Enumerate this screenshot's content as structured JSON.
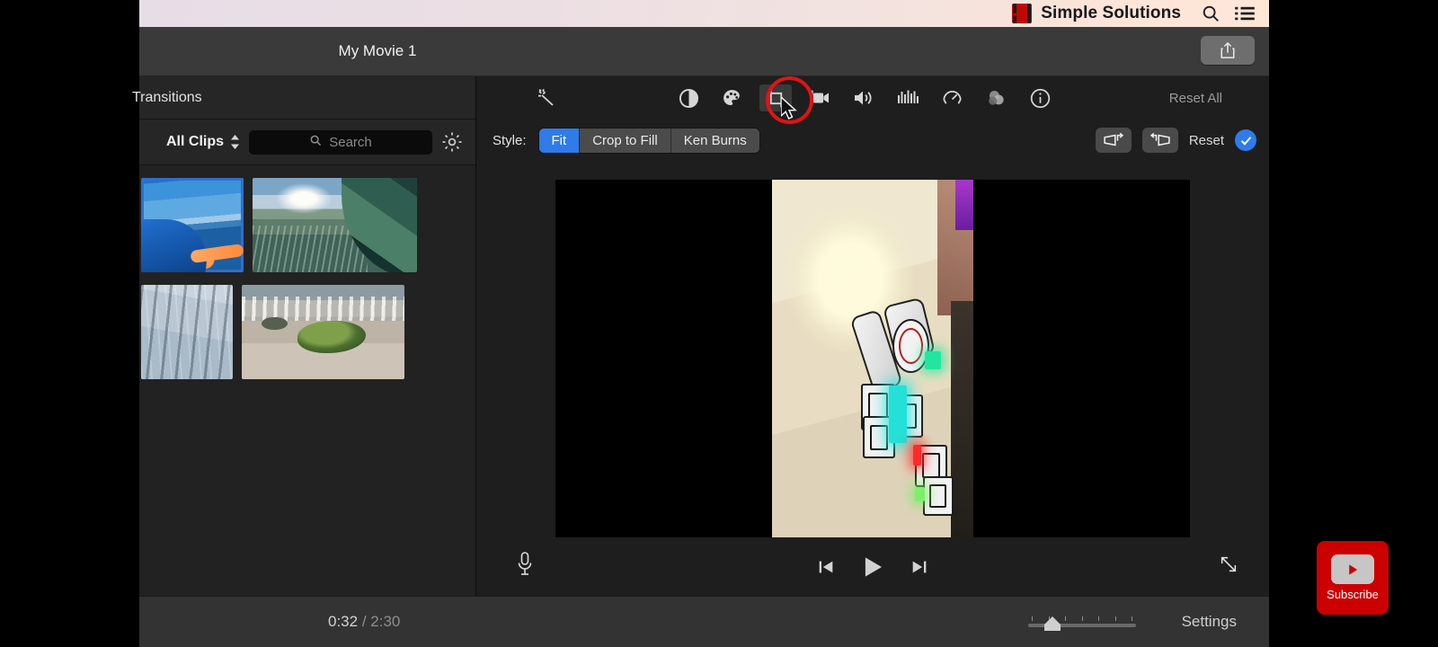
{
  "topbar": {
    "brand_name": "Simple Solutions",
    "logo_icon": "film-strip-icon",
    "search_icon": "search-icon",
    "menu_icon": "list-menu-icon",
    "gradient_start": "#e7dde6",
    "gradient_end": "#ffe7d8"
  },
  "titlebar": {
    "project_title": "My Movie 1",
    "share_icon": "share-upload-icon"
  },
  "library": {
    "tab_label": "Transitions",
    "filter": {
      "selected": "All Clips",
      "stepper_icon": "chevron-up-down-icon",
      "search_placeholder": "Search",
      "search_value": "",
      "search_icon": "search-icon",
      "settings_icon": "gear-icon"
    },
    "clips": [
      {
        "name": "kayak-clip",
        "selected": true
      },
      {
        "name": "wave-clip",
        "selected": false
      },
      {
        "name": "sand-ripples-clip",
        "selected": false
      },
      {
        "name": "mossy-rock-clip",
        "selected": false
      }
    ]
  },
  "adjust_toolbar": {
    "reset_all_label": "Reset All",
    "tools": [
      {
        "name": "auto-enhance-icon",
        "label": "Auto Enhance",
        "active": false
      },
      {
        "name": "color-balance-icon",
        "label": "Color Balance",
        "active": false
      },
      {
        "name": "color-correction-icon",
        "label": "Color Correction",
        "active": false
      },
      {
        "name": "crop-icon",
        "label": "Cropping",
        "active": true
      },
      {
        "name": "stabilization-icon",
        "label": "Stabilization",
        "active": false
      },
      {
        "name": "volume-icon",
        "label": "Volume",
        "active": false
      },
      {
        "name": "audio-equalizer-icon",
        "label": "Noise Reduction and Equalizer",
        "active": false
      },
      {
        "name": "speed-icon",
        "label": "Speed",
        "active": false
      },
      {
        "name": "clip-filter-icon",
        "label": "Clip Filter and Audio Effects",
        "active": false
      },
      {
        "name": "info-icon",
        "label": "Clip Information",
        "active": false
      }
    ]
  },
  "crop_controls": {
    "style_label": "Style:",
    "options": [
      {
        "label": "Fit",
        "selected": true
      },
      {
        "label": "Crop to Fill",
        "selected": false
      },
      {
        "label": "Ken Burns",
        "selected": false
      }
    ],
    "rotate_ccw_icon": "rotate-counterclockwise-icon",
    "rotate_cw_icon": "rotate-clockwise-icon",
    "reset_label": "Reset",
    "apply_icon": "checkmark-icon",
    "accent_color": "#2f7bea"
  },
  "playback": {
    "mic_icon": "microphone-icon",
    "skip_back_icon": "skip-to-start-icon",
    "play_icon": "play-icon",
    "skip_forward_icon": "skip-to-end-icon",
    "fullscreen_icon": "expand-diagonal-icon"
  },
  "statusbar": {
    "current_time": "0:32",
    "separator": "/",
    "total_time": "2:30",
    "settings_label": "Settings",
    "zoom_slider_value": 18
  },
  "annotation": {
    "highlight_color": "#e01414",
    "highlight_target": "crop-icon",
    "cursor_icon": "mouse-pointer-icon"
  },
  "overlay": {
    "subscribe_label": "Subscribe",
    "subscribe_color": "#cc0000",
    "play_icon": "youtube-play-icon"
  }
}
